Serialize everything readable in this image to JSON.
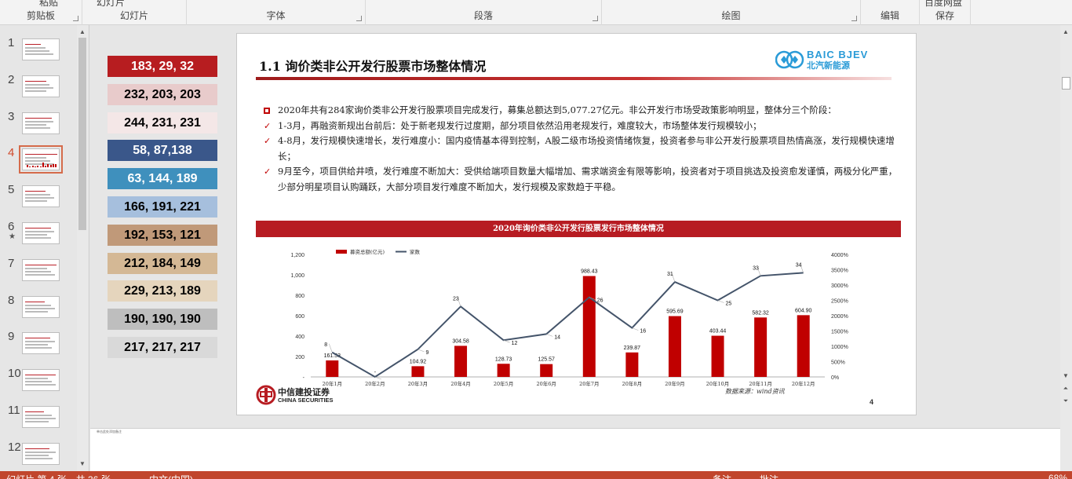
{
  "ribbon": {
    "groups": [
      {
        "label": "剪贴板",
        "cut": "粘贴"
      },
      {
        "label": "幻灯片",
        "cut": "幻灯片"
      },
      {
        "label": "字体",
        "cut": ""
      },
      {
        "label": "段落",
        "cut": ""
      },
      {
        "label": "绘图",
        "cut": ""
      },
      {
        "label": "编辑",
        "cut": ""
      },
      {
        "label": "保存",
        "cut": "百度网盘"
      }
    ]
  },
  "thumbnails": {
    "numbers": [
      "1",
      "2",
      "3",
      "4",
      "5",
      "6",
      "7",
      "8",
      "9",
      "10",
      "11",
      "12"
    ],
    "active_index": 4,
    "star_on": "6",
    "star_glyph": "★"
  },
  "swatches": [
    {
      "label": "183, 29, 32",
      "bg": "#b71d20",
      "fg": "#ffffff"
    },
    {
      "label": "232, 203, 203",
      "bg": "#e8cbcb",
      "fg": "#000000"
    },
    {
      "label": "244, 231, 231",
      "bg": "#f4e7e7",
      "fg": "#000000"
    },
    {
      "label": "58, 87,138",
      "bg": "#3a578a",
      "fg": "#ffffff"
    },
    {
      "label": "63, 144, 189",
      "bg": "#3f90bd",
      "fg": "#ffffff"
    },
    {
      "label": "166, 191, 221",
      "bg": "#a6bfdd",
      "fg": "#000000"
    },
    {
      "label": "192, 153, 121",
      "bg": "#c09979",
      "fg": "#000000"
    },
    {
      "label": "212, 184, 149",
      "bg": "#d4b895",
      "fg": "#000000"
    },
    {
      "label": "229, 213, 189",
      "bg": "#e5d5bd",
      "fg": "#000000"
    },
    {
      "label": "190, 190, 190",
      "bg": "#bebebe",
      "fg": "#000000"
    },
    {
      "label": "217, 217, 217",
      "bg": "#d9d9d9",
      "fg": "#000000"
    }
  ],
  "slide": {
    "title": "1.1 询价类非公开发行股票市场整体情况",
    "logo_en": "BAIC BJEV",
    "logo_cn": "北汽新能源",
    "bullets": [
      {
        "marker": "box",
        "text": "2020年共有284家询价类非公开发行股票项目完成发行，募集总额达到5,077.27亿元。非公开发行市场受政策影响明显，整体分三个阶段："
      },
      {
        "marker": "check",
        "text": "1-3月，再融资新规出台前后：处于新老规发行过度期，部分项目依然沿用老规发行，难度较大，市场整体发行规模较小；"
      },
      {
        "marker": "check",
        "text": "4-8月，发行规模快速增长，发行难度小：国内疫情基本得到控制，A股二级市场投资情绪恢复，投资者参与非公开发行股票项目热情高涨，发行规模快速增长；"
      },
      {
        "marker": "check",
        "text": "9月至今，项目供给井喷，发行难度不断加大：受供给端项目数量大幅增加、需求端资金有限等影响，投资者对于项目挑选及投资愈发谨慎，两极分化严重，少部分明星项目认购踊跃，大部分项目发行难度不断加大，发行规模及家数趋于平稳。"
      }
    ],
    "check_glyph": "✓",
    "chart_title": "2020年询价类非公开发行股票发行市场整体情况",
    "source": "数据来源：wind资讯",
    "page_number": "4",
    "cs_logo_cn": "中信建投证券",
    "cs_logo_en": "CHINA SECURITIES"
  },
  "chart_data": {
    "type": "bar",
    "categories": [
      "20年1月",
      "20年2月",
      "20年3月",
      "20年4月",
      "20年5月",
      "20年6月",
      "20年7月",
      "20年8月",
      "20年9月",
      "20年10月",
      "20年11月",
      "20年12月"
    ],
    "series": [
      {
        "name": "募资总额(亿元)",
        "type": "bar",
        "axis": "left",
        "color": "#c00000",
        "values": [
          161.53,
          0,
          104.92,
          304.58,
          128.73,
          125.57,
          988.43,
          239.87,
          595.69,
          403.44,
          582.32,
          604.9
        ],
        "labels": [
          "161.53",
          "-",
          "104.92",
          "304.58",
          "128.73",
          "125.57",
          "988.43",
          "239.87",
          "595.69",
          "403.44",
          "582.32",
          "604.90"
        ]
      },
      {
        "name": "家数",
        "type": "line",
        "axis": "right",
        "color": "#44546a",
        "values": [
          8,
          0,
          9,
          23,
          12,
          14,
          26,
          16,
          31,
          25,
          33,
          34
        ]
      }
    ],
    "left_ticks": [
      "-",
      "200",
      "400",
      "600",
      "800",
      "1,000",
      "1,200"
    ],
    "left_range": [
      0,
      1200
    ],
    "right_ticks": [
      "0%",
      "500%",
      "1000%",
      "1500%",
      "2000%",
      "2500%",
      "3000%",
      "3500%",
      "4000%"
    ],
    "right_range": [
      0,
      40
    ],
    "legend": "top-left"
  },
  "notes": {
    "text": "单击此处添加备注"
  },
  "status": {
    "left": "幻灯片 第 4 张，共 36 张",
    "lang": "中文(中国)",
    "notes_btn": "备注",
    "comments_btn": "批注",
    "zoom": "68%"
  }
}
